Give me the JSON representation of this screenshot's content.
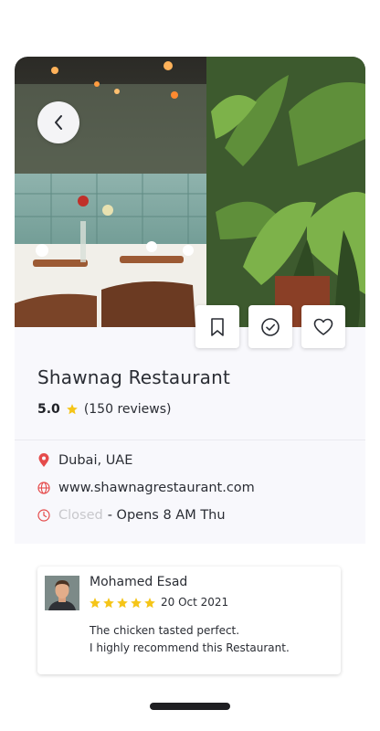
{
  "restaurant": {
    "name": "Shawnag Restaurant",
    "rating": "5.0",
    "reviews": "(150 reviews)",
    "location": "Dubai, UAE",
    "website": "www.shawnagrestaurant.com",
    "status_closed": "Closed",
    "status_opens": "- Opens 8 AM Thu"
  },
  "review": {
    "author": "Mohamed Esad",
    "stars": 5,
    "date": "20 Oct 2021",
    "line1": "The chicken tasted perfect.",
    "line2": "I highly recommend this Restaurant."
  },
  "colors": {
    "accent_red": "#e54b4b",
    "star_yellow": "#f5c518",
    "background": "#f8f8fc"
  },
  "icons": {
    "back": "chevron-left-icon",
    "bookmark": "bookmark-icon",
    "check": "check-circle-icon",
    "heart": "heart-icon",
    "location": "map-pin-icon",
    "website": "globe-icon",
    "hours": "clock-icon"
  }
}
